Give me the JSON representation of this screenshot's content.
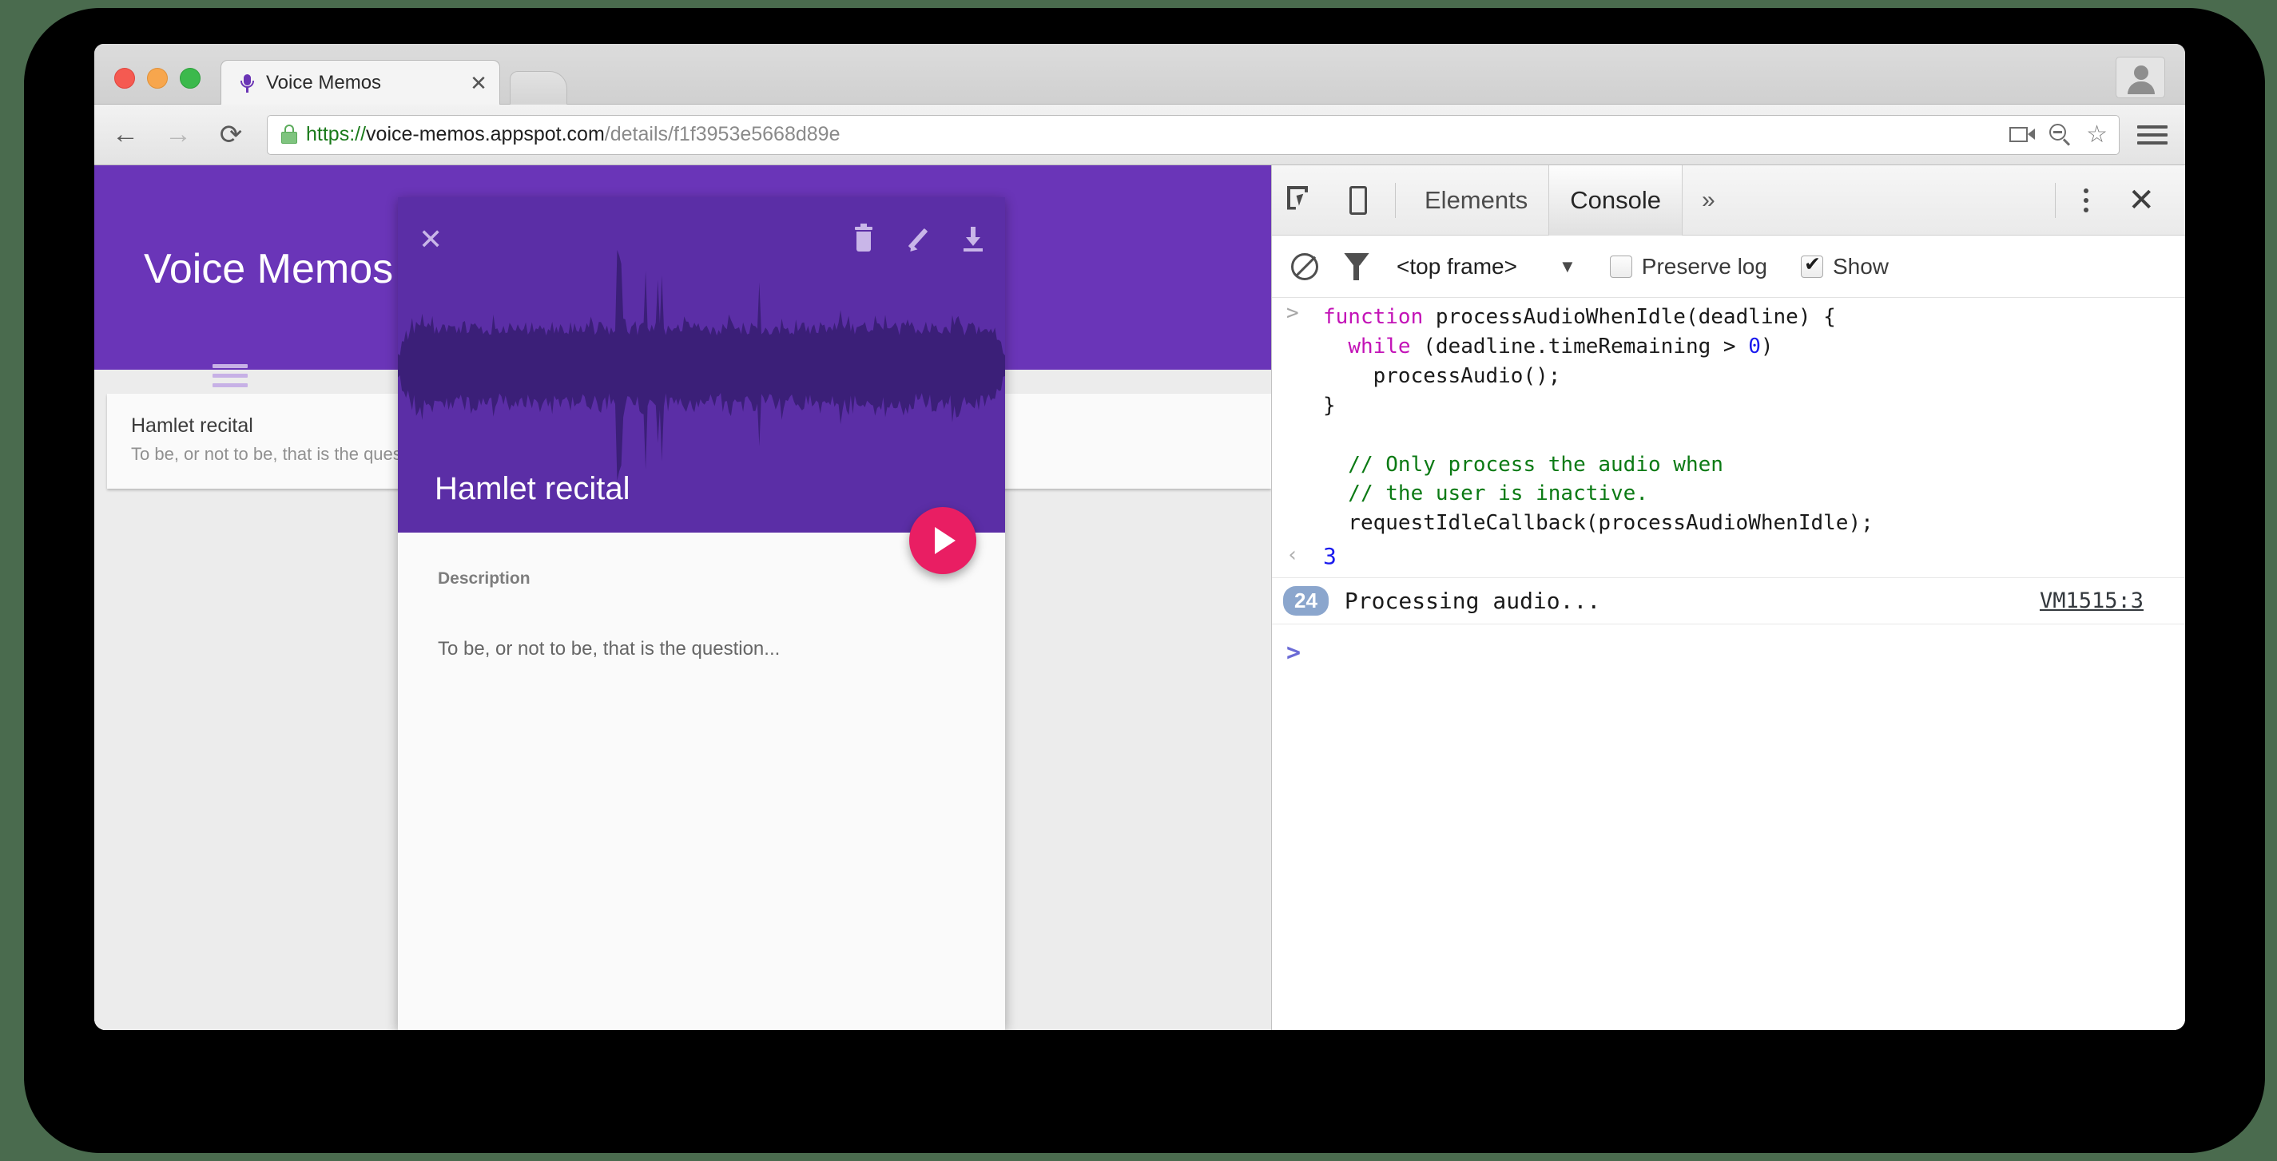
{
  "browser": {
    "traffic_lights": [
      "close",
      "minimize",
      "zoom"
    ],
    "tab": {
      "title": "Voice Memos",
      "favicon": "microphone-icon",
      "close": "✕"
    },
    "new_tab_label": "+",
    "nav": {
      "back": "←",
      "forward": "→",
      "reload": "⟳"
    },
    "omnibox": {
      "secure_icon": "lock-icon",
      "scheme": "https://",
      "host": "voice-memos.appspot.com",
      "path": "/details/f1f3953e5668d89e",
      "cast_icon": "cast-icon",
      "zoom_icon": "zoom-out-icon",
      "bookmark_icon": "☆"
    },
    "menu_icon": "hamburger-menu-icon",
    "profile_icon": "profile-avatar-icon"
  },
  "app": {
    "menu_icon": "hamburger-menu-icon",
    "title": "Voice Memos",
    "memos": [
      {
        "title": "Hamlet recital",
        "subtitle": "To be, or not to be, that is the question..."
      }
    ],
    "detail": {
      "close_label": "✕",
      "actions": [
        "delete-icon",
        "edit-icon",
        "download-icon"
      ],
      "title": "Hamlet recital",
      "play_label": "play-icon",
      "description_label": "Description",
      "description_text": "To be, or not to be, that is the question..."
    },
    "colors": {
      "primary": "#6a35b8",
      "hero": "#5b2ea6",
      "accent": "#e91e63"
    }
  },
  "devtools": {
    "inspect_icon": "inspect-element-icon",
    "device_icon": "device-toolbar-icon",
    "tabs": [
      {
        "label": "Elements",
        "active": false
      },
      {
        "label": "Console",
        "active": true
      }
    ],
    "more_tabs_label": "»",
    "kebab_label": "more-options-icon",
    "close_label": "✕",
    "filterbar": {
      "clear_icon": "clear-console-icon",
      "filter_icon": "filter-icon",
      "frame_selector": "<top frame>",
      "caret": "▼",
      "preserve_log": {
        "label": "Preserve log",
        "checked": false
      },
      "show_all": {
        "label": "Show",
        "checked": true
      }
    },
    "console": {
      "input_prompt": ">",
      "result_prompt": "‹",
      "entry_lines": [
        {
          "tokens": [
            {
              "t": "function",
              "c": "kw"
            },
            {
              "t": " processAudioWhenIdle(deadline) {",
              "c": ""
            }
          ]
        },
        {
          "tokens": [
            {
              "t": "  ",
              "c": ""
            },
            {
              "t": "while",
              "c": "kw"
            },
            {
              "t": " (deadline.timeRemaining > ",
              "c": ""
            },
            {
              "t": "0",
              "c": "num"
            },
            {
              "t": ")",
              "c": ""
            }
          ]
        },
        {
          "tokens": [
            {
              "t": "    processAudio();",
              "c": ""
            }
          ]
        },
        {
          "tokens": [
            {
              "t": "}",
              "c": ""
            }
          ]
        },
        {
          "tokens": [
            {
              "t": "",
              "c": ""
            }
          ]
        },
        {
          "tokens": [
            {
              "t": "  // Only process the audio when",
              "c": "cmt"
            }
          ]
        },
        {
          "tokens": [
            {
              "t": "  // the user is inactive.",
              "c": "cmt"
            }
          ]
        },
        {
          "tokens": [
            {
              "t": "  requestIdleCallback(processAudioWhenIdle);",
              "c": ""
            }
          ]
        }
      ],
      "result_value": "3",
      "log": {
        "repeat_count": "24",
        "message": "Processing audio...",
        "source": "VM1515:3"
      },
      "prompt": ">"
    }
  }
}
